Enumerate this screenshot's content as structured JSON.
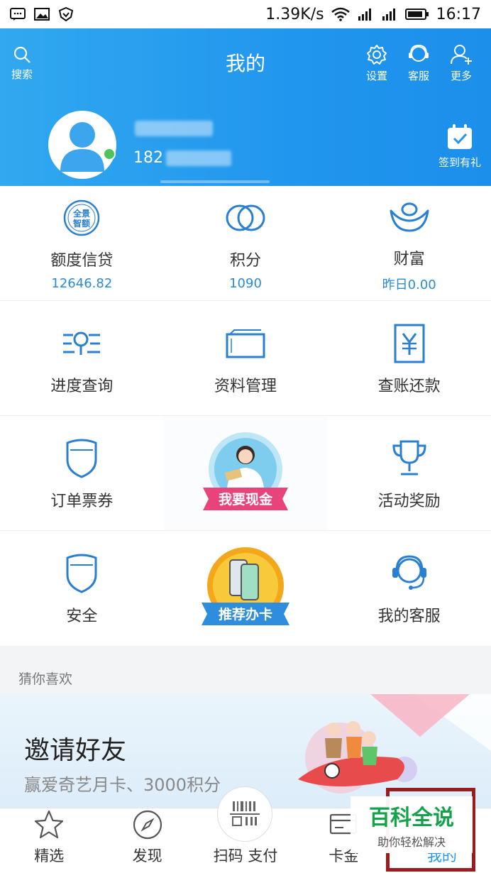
{
  "status_bar": {
    "speed": "1.39K/s",
    "time": "16:17"
  },
  "header": {
    "title": "我的",
    "search_label": "搜索",
    "settings_label": "设置",
    "service_label": "客服",
    "more_label": "更多",
    "phone_prefix": "182",
    "checkin_label": "签到有礼",
    "accent": "#2196ee"
  },
  "grid": {
    "quota": {
      "icon_text": "全景智额",
      "label": "额度信贷",
      "value": "12646.82"
    },
    "points": {
      "label": "积分",
      "value": "1090"
    },
    "wealth": {
      "label": "财富",
      "value": "昨日0.00"
    },
    "progress": {
      "label": "进度查询"
    },
    "data": {
      "label": "资料管理"
    },
    "bill": {
      "label": "查账还款"
    },
    "orders": {
      "label": "订单票券"
    },
    "cash": {
      "label": "我要现金"
    },
    "rewards": {
      "label": "活动奖励"
    },
    "security": {
      "label": "安全"
    },
    "card": {
      "label": "推荐办卡"
    },
    "my_service": {
      "label": "我的客服"
    }
  },
  "guess": {
    "title": "猜你喜欢"
  },
  "banner": {
    "title": "邀请好友",
    "subtitle": "赢爱奇艺月卡、3000积分"
  },
  "bottom_nav": {
    "featured": "精选",
    "discover": "发现",
    "scan": "扫码 支付",
    "card": "卡金",
    "mine": "我的"
  },
  "watermark": {
    "title": "百科全说",
    "subtitle": "助你轻松解决"
  }
}
